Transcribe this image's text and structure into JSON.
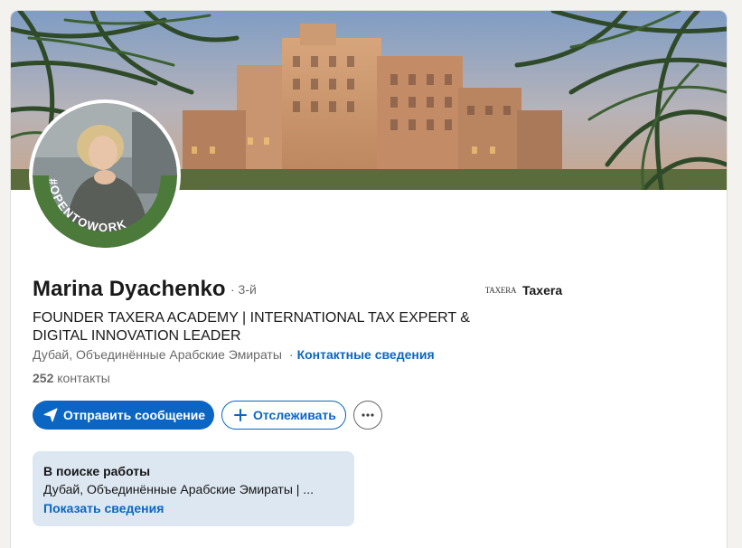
{
  "profile": {
    "name": "Marina Dyachenko",
    "degree": "· 3-й",
    "headline": "FOUNDER TAXERA ACADEMY | INTERNATIONAL TAX EXPERT & DIGITAL INNOVATION LEADER",
    "location": "Дубай, Объединённые Арабские Эмираты",
    "location_separator": "·",
    "contact_link": "Контактные сведения",
    "connections_count": "252",
    "connections_label": "контакты",
    "open_to_work_badge": "#OPENTOWORK"
  },
  "company": {
    "logo_text": "TAXERA",
    "name": "Taxera"
  },
  "actions": {
    "message_label": "Отправить сообщение",
    "follow_label": "Отслеживать",
    "more_label": "···"
  },
  "open_to_work": {
    "title": "В поиске работы",
    "text": "Дубай, Объединённые Арабские Эмираты | ...",
    "link": "Показать сведения"
  },
  "icons": {
    "message": "send-icon",
    "follow": "plus-icon",
    "more": "ellipsis-icon"
  },
  "colors": {
    "accent": "#0a66c2",
    "otw_green": "#4b7a3a",
    "otw_box": "#dde7f1"
  }
}
